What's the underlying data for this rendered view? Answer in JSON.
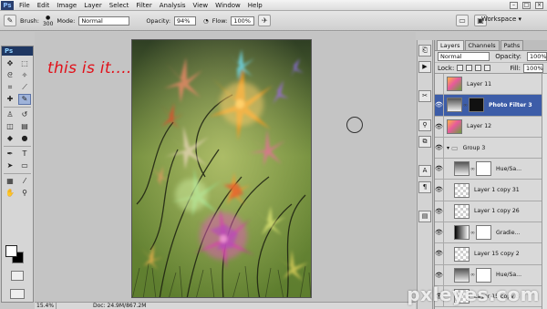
{
  "app": {
    "logo": "Ps"
  },
  "menu": [
    "File",
    "Edit",
    "Image",
    "Layer",
    "Select",
    "Filter",
    "Analysis",
    "View",
    "Window",
    "Help"
  ],
  "options": {
    "brush_label": "Brush:",
    "brush_size": "300",
    "mode_label": "Mode:",
    "mode_value": "Normal",
    "opacity_label": "Opacity:",
    "opacity_value": "94%",
    "flow_label": "Flow:",
    "flow_value": "100%",
    "workspace_label": "Workspace"
  },
  "canvas": {
    "annotation": "this is it......"
  },
  "status": {
    "zoom": "15.4%",
    "doc": "Doc: 24.9M/867.2M"
  },
  "layers_panel": {
    "tabs": [
      "Layers",
      "Channels",
      "Paths"
    ],
    "blend_mode": "Normal",
    "opacity_label": "Opacity:",
    "opacity_value": "100%",
    "lock_label": "Lock:",
    "fill_label": "Fill:",
    "fill_value": "100%",
    "layers": [
      {
        "name": "Layer 11"
      },
      {
        "name": "Photo Filter 3"
      },
      {
        "name": "Layer 12"
      },
      {
        "name": "Group 3"
      },
      {
        "name": "Hue/Sa..."
      },
      {
        "name": "Layer 1 copy 31"
      },
      {
        "name": "Layer 1 copy 26"
      },
      {
        "name": "Gradie..."
      },
      {
        "name": "Layer 15 copy 2"
      },
      {
        "name": "Hue/Sa..."
      },
      {
        "name": "Layer 15 copy 3"
      }
    ]
  },
  "watermark": "pxleyes.com",
  "colors": {
    "annotation": "#e1111a",
    "selected_layer": "#3d5da8",
    "panel_bg": "#d9d9d9"
  }
}
